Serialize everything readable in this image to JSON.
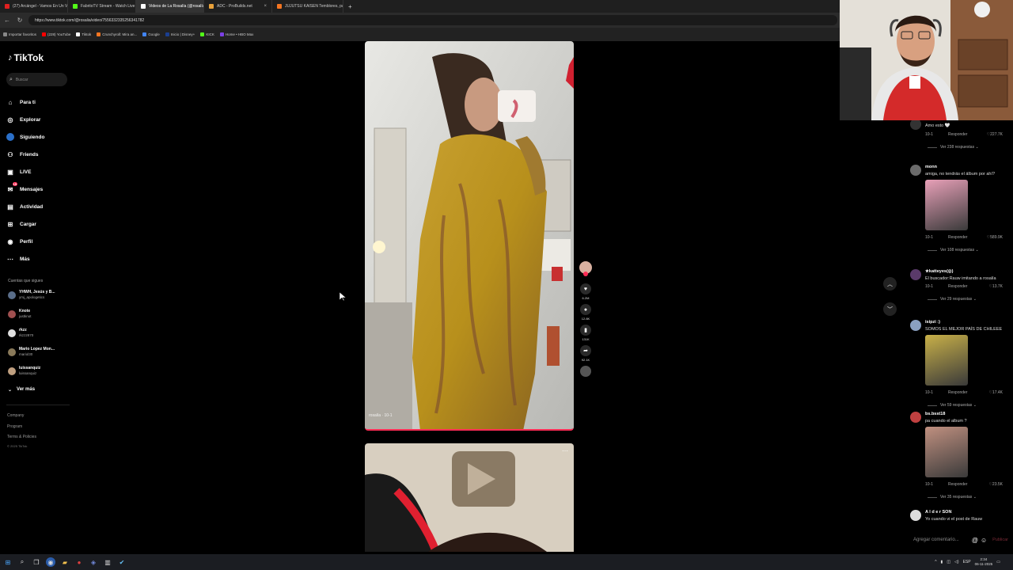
{
  "browser": {
    "tabs": [
      {
        "label": "(27) Arcángel - Vamos En Un Viaj",
        "color": "#e02020"
      },
      {
        "label": "FabritoTV Stream - Watch Live on",
        "color": "#53fc18"
      },
      {
        "label": "Videos de La Rosalía (@rosalía",
        "color": "#ffffff"
      },
      {
        "label": "ADC - ProBuilds.net",
        "color": "#e8a13a"
      },
      {
        "label": "JUJUTSU KAISEN Temblores, par",
        "color": "#f47521"
      }
    ],
    "new_tab": "+",
    "url": "https://www.tiktok.com/@rosalia/video/7556332335256341782",
    "bookmarks": [
      {
        "label": "Importar favoritos",
        "color": "#888888"
      },
      {
        "label": "(228) YouTube",
        "color": "#ff0000"
      },
      {
        "label": "Tiktok",
        "color": "#ffffff"
      },
      {
        "label": "Crunchyroll: Mira an...",
        "color": "#f47521"
      },
      {
        "label": "Google",
        "color": "#4285f4"
      },
      {
        "label": "Inicio | Disney+",
        "color": "#1a3e8f"
      },
      {
        "label": "KICK",
        "color": "#53fc18"
      },
      {
        "label": "Home • HBO Max",
        "color": "#7b3fe4"
      }
    ]
  },
  "tiktok": {
    "logo": "TikTok",
    "search_placeholder": "Buscar",
    "nav": [
      {
        "icon": "home-icon",
        "glyph": "⌂",
        "label": "Para ti"
      },
      {
        "icon": "compass-icon",
        "glyph": "◎",
        "label": "Explorar"
      },
      {
        "icon": "following-icon",
        "glyph": "●",
        "label": "Siguiendo"
      },
      {
        "icon": "friends-icon",
        "glyph": "⚇",
        "label": "Friends"
      },
      {
        "icon": "live-icon",
        "glyph": "▣",
        "label": "LIVE"
      },
      {
        "icon": "messages-icon",
        "glyph": "✉",
        "label": "Mensajes",
        "badge": "15"
      },
      {
        "icon": "activity-icon",
        "glyph": "▤",
        "label": "Actividad"
      },
      {
        "icon": "upload-icon",
        "glyph": "⊞",
        "label": "Cargar"
      },
      {
        "icon": "profile-icon",
        "glyph": "◉",
        "label": "Perfil"
      },
      {
        "icon": "more-icon",
        "glyph": "⋯",
        "label": "Más"
      }
    ],
    "following_header": "Cuentas que sigues",
    "following": [
      {
        "name": "YHWH, Jesús y B...",
        "user": "ymj_apologetics",
        "color": "#5a6e8a"
      },
      {
        "name": "Knote",
        "user": "justknot",
        "color": "#a05050"
      },
      {
        "name": "rkzz",
        "user": "rkzz2870",
        "color": "#e0e0e0"
      },
      {
        "name": "Mario Lopez Mon...",
        "user": "mariol30",
        "color": "#8a7a5a"
      },
      {
        "name": "luissanquiz",
        "user": "luissanquiz",
        "color": "#c0a080"
      }
    ],
    "ver_mas": "Ver más",
    "footer": [
      "Company",
      "Program",
      "Terms & Policies"
    ],
    "copyright": "© 2025 TikTok"
  },
  "video": {
    "author": "rosalía",
    "date": "10-1",
    "actions": [
      {
        "icon": "heart-icon",
        "glyph": "♥",
        "count": "6.2M"
      },
      {
        "icon": "comment-icon",
        "glyph": "●",
        "count": "12.8K"
      },
      {
        "icon": "bookmark-icon",
        "glyph": "▮",
        "count": "131K"
      },
      {
        "icon": "share-icon",
        "glyph": "➦",
        "count": "92.1K"
      }
    ],
    "more": "⋯"
  },
  "comments": [
    {
      "user": "",
      "text": "Amo esto 🤍",
      "date": "10-1",
      "reply": "Responder",
      "likes": "227.7K",
      "replies": "Ver 238 respuestas ⌄",
      "has_image": false,
      "color": "#333333"
    },
    {
      "user": "monn",
      "text": "amiga, no tendrás el álbum por ahí?",
      "date": "10-1",
      "reply": "Responder",
      "likes": "589.9K",
      "replies": "Ver 108 respuestas ⌄",
      "has_image": true,
      "color": "#6b6b6b",
      "img_color": "#e8a0b8"
    },
    {
      "user": "★katteyes(◎)",
      "text": "El buscador:Rauw imitando a rosalía",
      "date": "10-1",
      "reply": "Responder",
      "likes": "13.7K",
      "replies": "Ver 29 respuestas ⌄",
      "has_image": false,
      "color": "#5a3a6a"
    },
    {
      "user": "isipzi :)",
      "text": "SOMOS EL MEJOR PAÍS DE CHILEEE",
      "date": "10-1",
      "reply": "Responder",
      "likes": "17.4K",
      "replies": "Ver 59 respuestas ⌄",
      "has_image": true,
      "color": "#8aa0c0",
      "img_color": "#c8b048"
    },
    {
      "user": "bs.bsst18",
      "text": "pa cuando el album ?",
      "date": "10-1",
      "reply": "Responder",
      "likes": "23.5K",
      "replies": "Ver 35 respuestas ⌄",
      "has_image": true,
      "color": "#c04040",
      "img_color": "#c09080"
    },
    {
      "user": "A l d e r SON",
      "text": "Yo cuando vi el post de Rauw",
      "has_image": false,
      "color": "#dddddd"
    }
  ],
  "comment_input": {
    "placeholder": "Agregar comentario...",
    "at": "@",
    "emoji": "☺",
    "publish": "Publicar"
  },
  "taskbar": {
    "lang": "ESP",
    "time": "2:34",
    "date": "06-11-2025"
  }
}
